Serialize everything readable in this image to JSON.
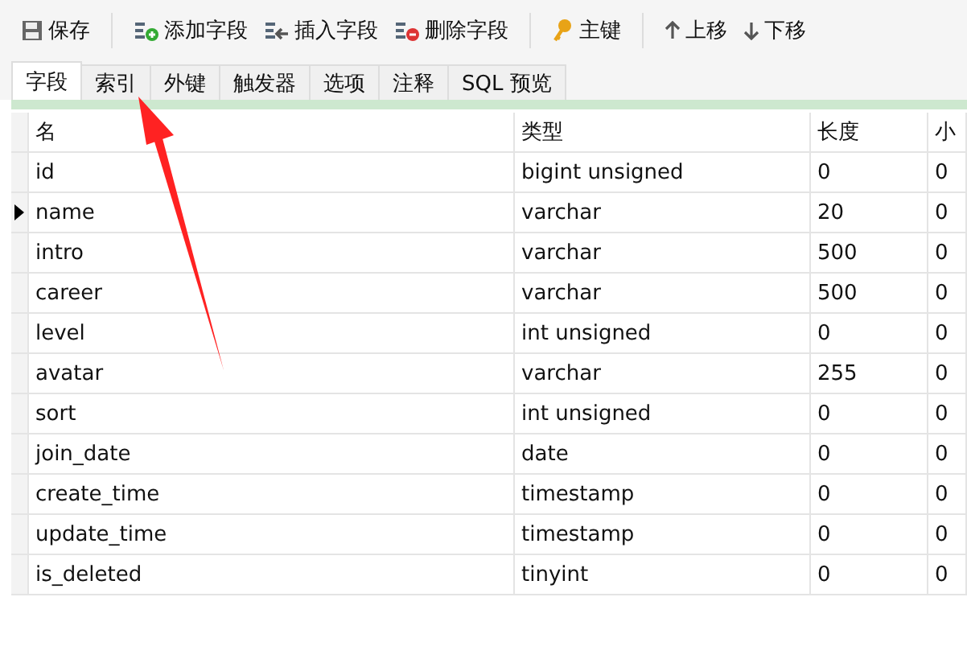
{
  "toolbar": [
    {
      "kind": "save",
      "label": "保存"
    },
    {
      "kind": "sep"
    },
    {
      "kind": "add",
      "label": "添加字段"
    },
    {
      "kind": "insert",
      "label": "插入字段"
    },
    {
      "kind": "delete",
      "label": "删除字段"
    },
    {
      "kind": "sep"
    },
    {
      "kind": "key",
      "label": "主键"
    },
    {
      "kind": "sep"
    },
    {
      "kind": "up",
      "label": "上移"
    },
    {
      "kind": "down",
      "label": "下移"
    }
  ],
  "tabs": [
    {
      "label": "字段",
      "selected": true
    },
    {
      "label": "索引",
      "selected": false
    },
    {
      "label": "外键",
      "selected": false
    },
    {
      "label": "触发器",
      "selected": false
    },
    {
      "label": "选项",
      "selected": false
    },
    {
      "label": "注释",
      "selected": false
    },
    {
      "label": "SQL 预览",
      "selected": false
    }
  ],
  "table": {
    "columns": [
      "名",
      "类型",
      "长度",
      "小"
    ],
    "rows": [
      {
        "cells": [
          "id",
          "bigint unsigned",
          "0",
          "0"
        ],
        "current": false
      },
      {
        "cells": [
          "name",
          "varchar",
          "20",
          "0"
        ],
        "current": true
      },
      {
        "cells": [
          "intro",
          "varchar",
          "500",
          "0"
        ],
        "current": false
      },
      {
        "cells": [
          "career",
          "varchar",
          "500",
          "0"
        ],
        "current": false
      },
      {
        "cells": [
          "level",
          "int unsigned",
          "0",
          "0"
        ],
        "current": false
      },
      {
        "cells": [
          "avatar",
          "varchar",
          "255",
          "0"
        ],
        "current": false
      },
      {
        "cells": [
          "sort",
          "int unsigned",
          "0",
          "0"
        ],
        "current": false
      },
      {
        "cells": [
          "join_date",
          "date",
          "0",
          "0"
        ],
        "current": false
      },
      {
        "cells": [
          "create_time",
          "timestamp",
          "0",
          "0"
        ],
        "current": false
      },
      {
        "cells": [
          "update_time",
          "timestamp",
          "0",
          "0"
        ],
        "current": false
      },
      {
        "cells": [
          "is_deleted",
          "tinyint",
          "0",
          "0"
        ],
        "current": false
      }
    ]
  },
  "annotation": {
    "kind": "arrow"
  }
}
